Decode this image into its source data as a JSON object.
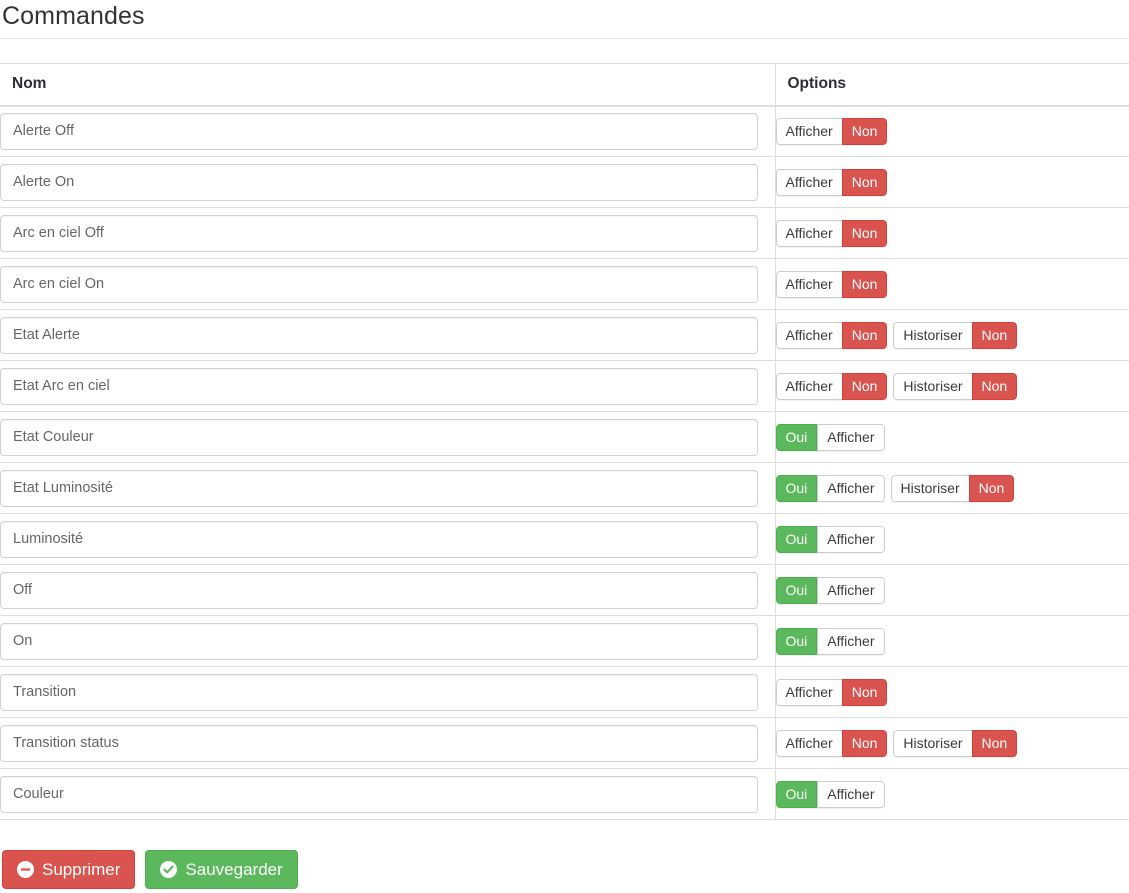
{
  "page": {
    "title": "Commandes"
  },
  "table": {
    "headers": {
      "name": "Nom",
      "options": "Options"
    },
    "labels": {
      "afficher": "Afficher",
      "historiser": "Historiser",
      "oui": "Oui",
      "non": "Non"
    },
    "rows": [
      {
        "name": "Alerte Off",
        "options": [
          {
            "label": "Afficher",
            "state": "Non"
          }
        ]
      },
      {
        "name": "Alerte On",
        "options": [
          {
            "label": "Afficher",
            "state": "Non"
          }
        ]
      },
      {
        "name": "Arc en ciel Off",
        "options": [
          {
            "label": "Afficher",
            "state": "Non"
          }
        ]
      },
      {
        "name": "Arc en ciel On",
        "options": [
          {
            "label": "Afficher",
            "state": "Non"
          }
        ]
      },
      {
        "name": "Etat Alerte",
        "options": [
          {
            "label": "Afficher",
            "state": "Non"
          },
          {
            "label": "Historiser",
            "state": "Non"
          }
        ]
      },
      {
        "name": "Etat Arc en ciel",
        "options": [
          {
            "label": "Afficher",
            "state": "Non"
          },
          {
            "label": "Historiser",
            "state": "Non"
          }
        ]
      },
      {
        "name": "Etat Couleur",
        "options": [
          {
            "label": "Afficher",
            "state": "Oui"
          }
        ]
      },
      {
        "name": "Etat Luminosité",
        "options": [
          {
            "label": "Afficher",
            "state": "Oui"
          },
          {
            "label": "Historiser",
            "state": "Non"
          }
        ]
      },
      {
        "name": "Luminosité",
        "options": [
          {
            "label": "Afficher",
            "state": "Oui"
          }
        ]
      },
      {
        "name": "Off",
        "options": [
          {
            "label": "Afficher",
            "state": "Oui"
          }
        ]
      },
      {
        "name": "On",
        "options": [
          {
            "label": "Afficher",
            "state": "Oui"
          }
        ]
      },
      {
        "name": "Transition",
        "options": [
          {
            "label": "Afficher",
            "state": "Non"
          }
        ]
      },
      {
        "name": "Transition status",
        "options": [
          {
            "label": "Afficher",
            "state": "Non"
          },
          {
            "label": "Historiser",
            "state": "Non"
          }
        ]
      },
      {
        "name": "Couleur",
        "options": [
          {
            "label": "Afficher",
            "state": "Oui"
          }
        ]
      }
    ]
  },
  "footer": {
    "delete_label": "Supprimer",
    "save_label": "Sauvegarder",
    "delete_icon": "minus-circle-icon",
    "save_icon": "check-circle-icon"
  },
  "colors": {
    "danger": "#d9534f",
    "success": "#5cb85c",
    "border": "#dddddd",
    "text": "#333333",
    "input_text": "#666666"
  }
}
